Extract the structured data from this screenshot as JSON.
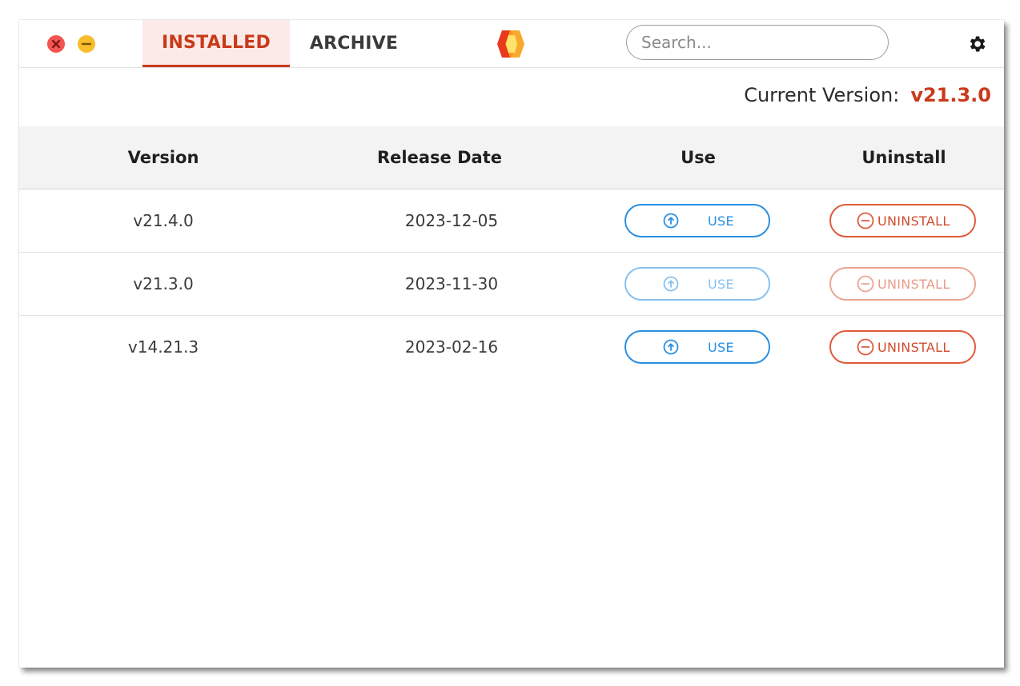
{
  "window": {
    "controls": {
      "close_icon": "close-icon",
      "minimize_icon": "minimize-icon"
    }
  },
  "tabs": [
    {
      "label": "INSTALLED",
      "active": true
    },
    {
      "label": "ARCHIVE",
      "active": false
    }
  ],
  "logo": {
    "icon": "hexagon-logo-icon"
  },
  "search": {
    "placeholder": "Search...",
    "value": ""
  },
  "settings": {
    "icon": "gear-icon"
  },
  "current_version": {
    "label": "Current Version:",
    "value": "v21.3.0"
  },
  "table": {
    "headers": {
      "version": "Version",
      "release_date": "Release Date",
      "use": "Use",
      "uninstall": "Uninstall"
    },
    "rows": [
      {
        "version": "v21.4.0",
        "release_date": "2023-12-05",
        "use_label": "USE",
        "uninstall_label": "UNINSTALL",
        "disabled": false
      },
      {
        "version": "v21.3.0",
        "release_date": "2023-11-30",
        "use_label": "USE",
        "uninstall_label": "UNINSTALL",
        "disabled": true
      },
      {
        "version": "v14.21.3",
        "release_date": "2023-02-16",
        "use_label": "USE",
        "uninstall_label": "UNINSTALL",
        "disabled": false
      }
    ]
  },
  "colors": {
    "accent": "#c93a1b",
    "use_blue": "#2a8fe0",
    "uninstall_red": "#e05a3c",
    "close_red": "#f35553",
    "minimize_yellow": "#f7bd2d"
  }
}
